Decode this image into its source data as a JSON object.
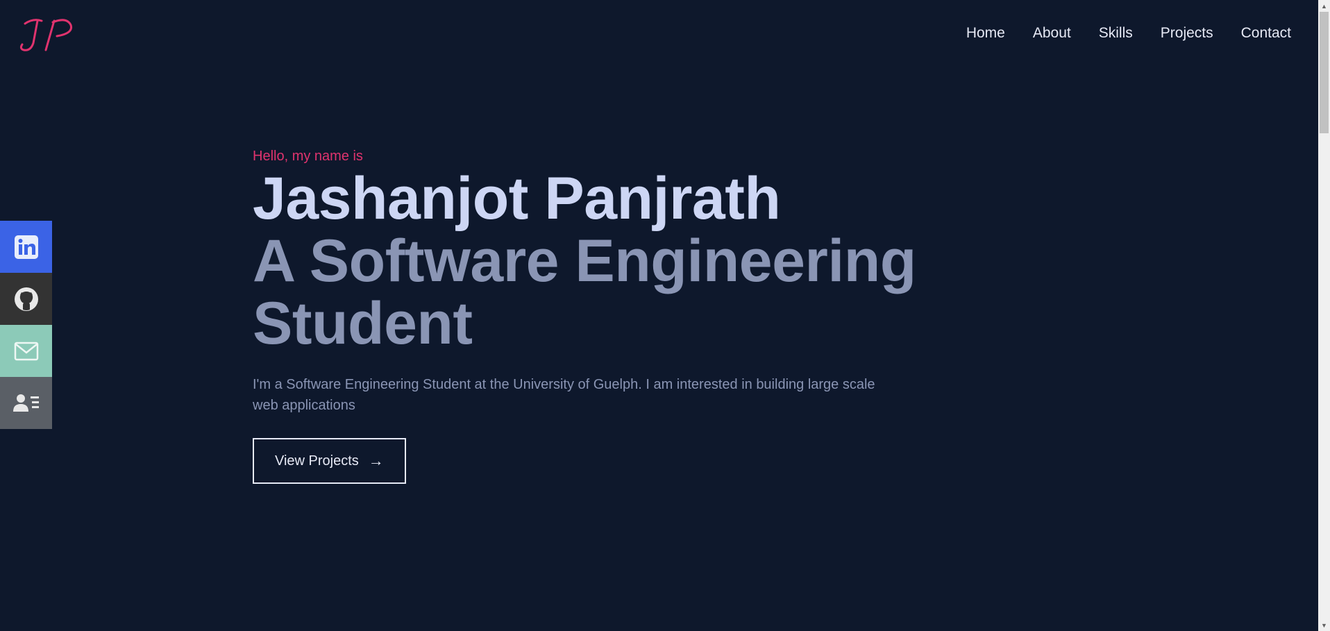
{
  "logo": {
    "text": "JP",
    "color": "#e0336e"
  },
  "nav": {
    "items": [
      {
        "label": "Home"
      },
      {
        "label": "About"
      },
      {
        "label": "Skills"
      },
      {
        "label": "Projects"
      },
      {
        "label": "Contact"
      }
    ]
  },
  "social": [
    {
      "name": "linkedin-icon",
      "color": "#3b63e6"
    },
    {
      "name": "github-icon",
      "color": "#333333"
    },
    {
      "name": "mail-icon",
      "color": "#8ccab8"
    },
    {
      "name": "resume-icon",
      "color": "#5a5f66"
    }
  ],
  "hero": {
    "greeting": "Hello, my name is",
    "name": "Jashanjot Panjrath",
    "tagline_line1": "A Software Engineering",
    "tagline_line2": "Student",
    "description": "I'm a Software Engineering Student at the University of Guelph. I am interested in building large scale web applications",
    "button_label": "View Projects",
    "button_arrow": "→"
  },
  "colors": {
    "background": "#0e182c",
    "accent": "#e0336e",
    "primary_text": "#cdd6f4",
    "secondary_text": "#8a95b4"
  }
}
